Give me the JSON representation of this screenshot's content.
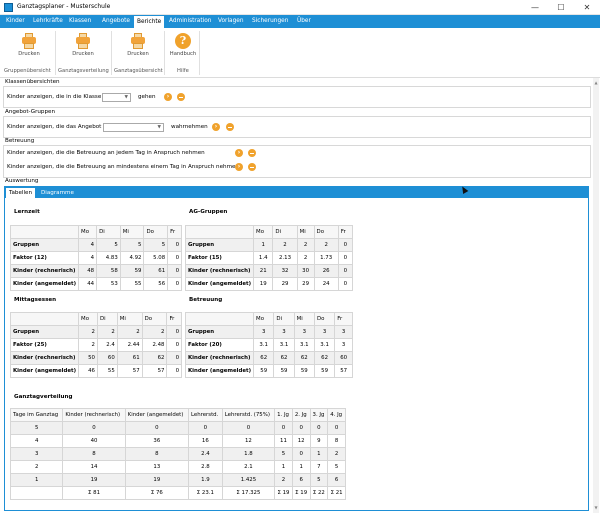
{
  "window": {
    "title": "Ganztagsplaner - Musterschule",
    "min": "—",
    "max": "☐",
    "close": "✕"
  },
  "menu": [
    "Kinder",
    "Lehrkräfte",
    "Klassen",
    "Angebote",
    "Berichte",
    "Administration",
    "Vorlagen",
    "Sicherungen",
    "Über"
  ],
  "menu_active": "Berichte",
  "ribbon": {
    "buttons": [
      {
        "label": "Drucken",
        "icon": "printer-icon"
      },
      {
        "label": "Drucken",
        "icon": "printer-icon"
      },
      {
        "label": "Drucken",
        "icon": "printer-icon"
      },
      {
        "label": "Handbuch",
        "icon": "help-icon"
      }
    ],
    "groups": [
      "Gruppenübersicht",
      "Ganztagsverteilung",
      "Ganztagsübersicht",
      "Hilfe"
    ]
  },
  "sections": {
    "klassen": {
      "title": "Klassenübersichten",
      "label": "Kinder anzeigen, die in die Klasse",
      "combo_value": "",
      "suffix": "gehen"
    },
    "angebot": {
      "title": "Angebot-Gruppen",
      "label": "Kinder anzeigen, die das Angebot",
      "combo_value": "",
      "suffix": "wahrnehmen"
    },
    "betreuung": {
      "title": "Betreuung",
      "line1": "Kinder anzeigen, die die Betreuung an jedem Tag in Anspruch nehmen",
      "line2": "Kinder anzeigen, die die Betreuung an mindestens einem Tag in Anspruch nehmen"
    },
    "auswertung": {
      "title": "Auswertung"
    }
  },
  "tabs": [
    "Tabellen",
    "Diagramme"
  ],
  "days": [
    "Mo",
    "Di",
    "Mi",
    "Do",
    "Fr"
  ],
  "tables": {
    "lernzeit": {
      "title": "Lernzeit",
      "rows": [
        {
          "label": "Gruppen",
          "values": [
            "4",
            "5",
            "5",
            "5",
            "0"
          ]
        },
        {
          "label": "Faktor (12)",
          "values": [
            "4",
            "4.83",
            "4.92",
            "5.08",
            "0"
          ]
        },
        {
          "label": "Kinder (rechnerisch)",
          "values": [
            "48",
            "58",
            "59",
            "61",
            "0"
          ]
        },
        {
          "label": "Kinder (angemeldet)",
          "values": [
            "44",
            "53",
            "55",
            "56",
            "0"
          ]
        }
      ]
    },
    "ag": {
      "title": "AG-Gruppen",
      "rows": [
        {
          "label": "Gruppen",
          "values": [
            "1",
            "2",
            "2",
            "2",
            "0"
          ]
        },
        {
          "label": "Faktor (15)",
          "values": [
            "1.4",
            "2.13",
            "2",
            "1.73",
            "0"
          ]
        },
        {
          "label": "Kinder (rechnerisch)",
          "values": [
            "21",
            "32",
            "30",
            "26",
            "0"
          ]
        },
        {
          "label": "Kinder (angemeldet)",
          "values": [
            "19",
            "29",
            "29",
            "24",
            "0"
          ]
        }
      ]
    },
    "mittagessen": {
      "title": "Mittagsessen",
      "rows": [
        {
          "label": "Gruppen",
          "values": [
            "2",
            "2",
            "2",
            "2",
            "0"
          ]
        },
        {
          "label": "Faktor (25)",
          "values": [
            "2",
            "2.4",
            "2.44",
            "2.48",
            "0"
          ]
        },
        {
          "label": "Kinder (rechnerisch)",
          "values": [
            "50",
            "60",
            "61",
            "62",
            "0"
          ]
        },
        {
          "label": "Kinder (angemeldet)",
          "values": [
            "46",
            "55",
            "57",
            "57",
            "0"
          ]
        }
      ]
    },
    "betreuung": {
      "title": "Betreuung",
      "rows": [
        {
          "label": "Gruppen",
          "values": [
            "3",
            "3",
            "3",
            "3",
            "3"
          ]
        },
        {
          "label": "Faktor (20)",
          "values": [
            "3.1",
            "3.1",
            "3.1",
            "3.1",
            "3"
          ]
        },
        {
          "label": "Kinder (rechnerisch)",
          "values": [
            "62",
            "62",
            "62",
            "62",
            "60"
          ]
        },
        {
          "label": "Kinder (angemeldet)",
          "values": [
            "59",
            "59",
            "59",
            "59",
            "57"
          ]
        }
      ]
    },
    "verteilung": {
      "title": "Ganztagverteilung",
      "headers": [
        "Tage im Ganztag",
        "Kinder (rechnerisch)",
        "Kinder (angemeldet)",
        "Lehrerstd.",
        "Lehrerstd. (75%)",
        "1. Jg",
        "2. Jg",
        "3. Jg",
        "4. Jg"
      ],
      "rows": [
        [
          "5",
          "0",
          "0",
          "0",
          "0",
          "0",
          "0",
          "0",
          "0"
        ],
        [
          "4",
          "40",
          "36",
          "16",
          "12",
          "11",
          "12",
          "9",
          "8"
        ],
        [
          "3",
          "8",
          "8",
          "2.4",
          "1.8",
          "5",
          "0",
          "1",
          "2"
        ],
        [
          "2",
          "14",
          "13",
          "2.8",
          "2.1",
          "1",
          "1",
          "7",
          "5"
        ],
        [
          "1",
          "19",
          "19",
          "1.9",
          "1.425",
          "2",
          "6",
          "5",
          "6"
        ],
        [
          "",
          "Σ 81",
          "Σ 76",
          "Σ 23.1",
          "Σ 17.325",
          "Σ 19",
          "Σ 19",
          "Σ 22",
          "Σ 21"
        ]
      ]
    }
  },
  "colors": {
    "accent": "#1e8fd5",
    "icon_orange": "#f0a22c"
  }
}
